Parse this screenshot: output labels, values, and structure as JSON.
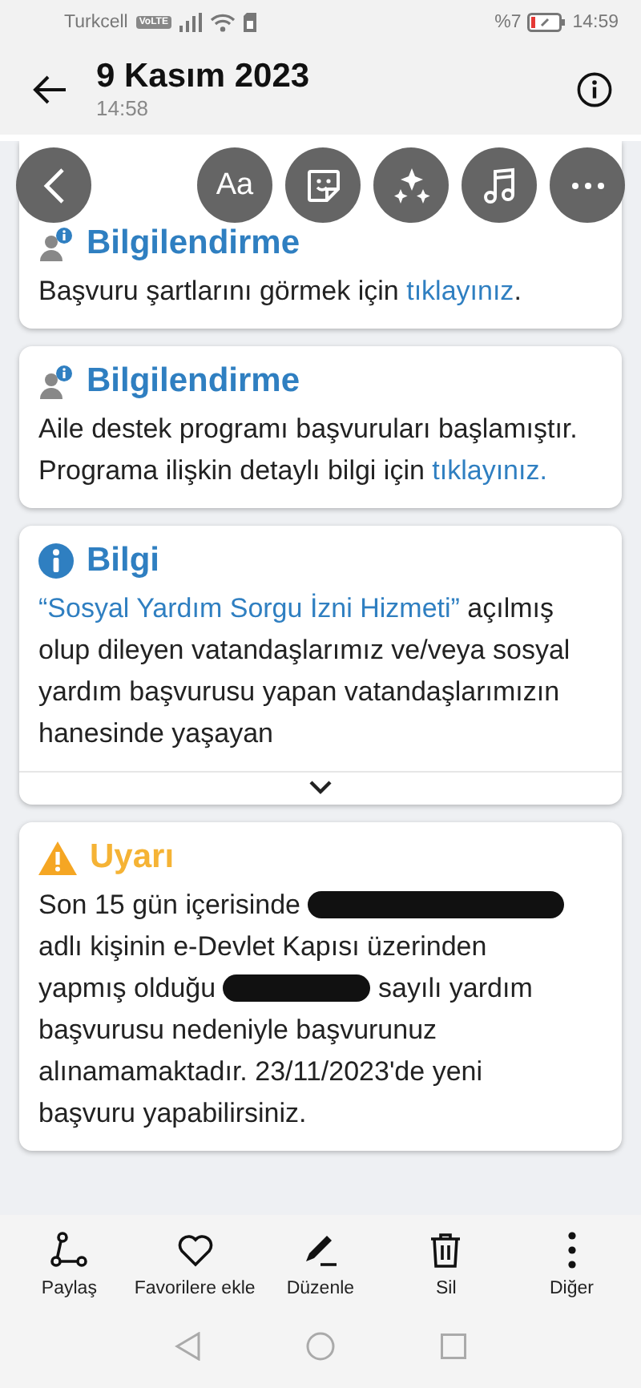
{
  "status_bar": {
    "carrier": "Turkcell",
    "network_badge": "VoLTE",
    "battery": "%7",
    "time": "14:59"
  },
  "header": {
    "title": "9 Kasım 2023",
    "subtitle": "14:58"
  },
  "edit_toolbar": [
    {
      "kind": "back"
    },
    {
      "kind": "text",
      "label": "Aa"
    },
    {
      "kind": "sticker"
    },
    {
      "kind": "sparkle"
    },
    {
      "kind": "music"
    },
    {
      "kind": "more"
    }
  ],
  "cards": [
    {
      "kind": "person-info",
      "title": "Bilgilendirme",
      "body": [
        {
          "kind": "text",
          "text": "Başvuru şartlarını görmek için "
        },
        {
          "kind": "link",
          "text": "tıklayınız"
        },
        {
          "kind": "text",
          "text": "."
        }
      ]
    },
    {
      "kind": "person-info",
      "title": "Bilgilendirme",
      "body": [
        {
          "kind": "text",
          "text": "Aile destek programı başvuruları başlamıştır. Programa ilişkin detaylı bilgi için "
        },
        {
          "kind": "link",
          "text": "tıklayınız."
        }
      ]
    },
    {
      "kind": "info",
      "title": "Bilgi",
      "collapsed": true,
      "body": [
        {
          "kind": "link",
          "text": "“Sosyal Yardım Sorgu İzni Hizmeti”"
        },
        {
          "kind": "text",
          "text": " açılmış olup dileyen vatandaşlarımız ve/veya sosyal yardım başvurusu yapan vatandaşlarımızın hanesinde yaşayan"
        }
      ]
    },
    {
      "kind": "warning",
      "title": "Uyarı",
      "body": [
        {
          "kind": "text",
          "text": "Son 15 gün içerisinde "
        },
        {
          "kind": "long-redaction"
        },
        {
          "kind": "text",
          "text": " adlı kişinin e-Devlet Kapısı üzerinden yapmış olduğu "
        },
        {
          "kind": "short-redaction"
        },
        {
          "kind": "text",
          "text": " sayılı yardım başvurusu nedeniyle başvurunuz alınamamaktadır. 23/11/2023'de yeni başvuru yapabilirsiniz."
        }
      ]
    }
  ],
  "actions": [
    {
      "kind": "share",
      "label": "Paylaş"
    },
    {
      "kind": "favorite",
      "label": "Favorilere ekle"
    },
    {
      "kind": "edit",
      "label": "Düzenle"
    },
    {
      "kind": "delete",
      "label": "Sil"
    },
    {
      "kind": "more",
      "label": "Diğer"
    }
  ],
  "nav_buttons": [
    {
      "kind": "back"
    },
    {
      "kind": "home"
    },
    {
      "kind": "recents"
    }
  ]
}
